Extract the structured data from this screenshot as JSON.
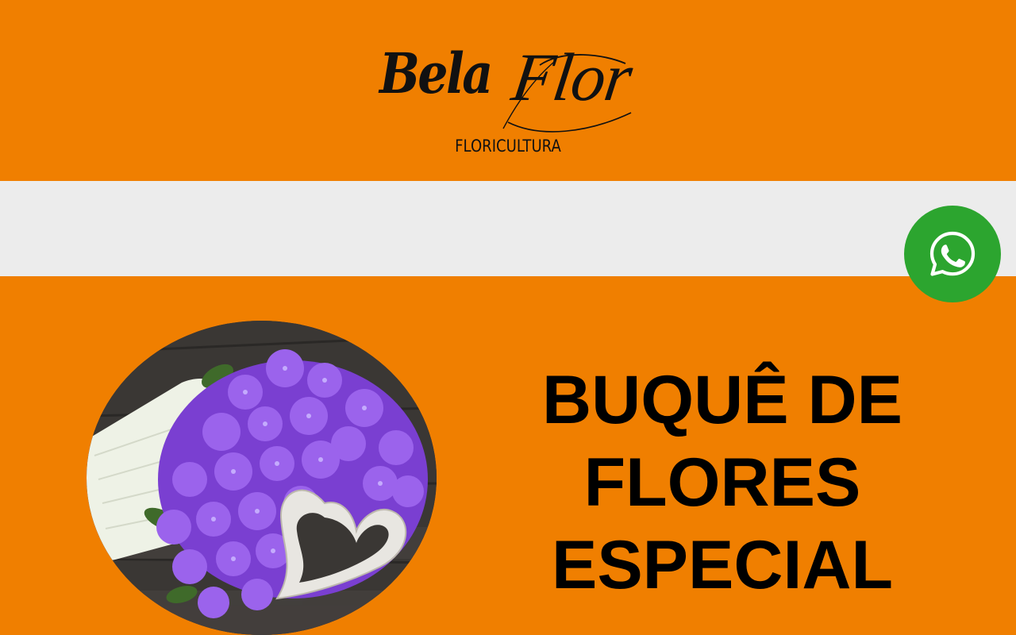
{
  "brand": {
    "name_part1": "Bela",
    "name_part2": "Flor",
    "subtitle": "FLORICULTURA"
  },
  "hero": {
    "title_lines": [
      "BUQUÊ DE",
      "FLORES",
      "ESPECIAL"
    ]
  },
  "floating": {
    "whatsapp_icon": "whatsapp-icon"
  },
  "colors": {
    "primary_orange": "#f07f00",
    "nav_band_gray": "#ececec",
    "whatsapp_green": "#2ca52f",
    "text_dark": "#111111",
    "flower_purple": "#8a4fd8"
  }
}
